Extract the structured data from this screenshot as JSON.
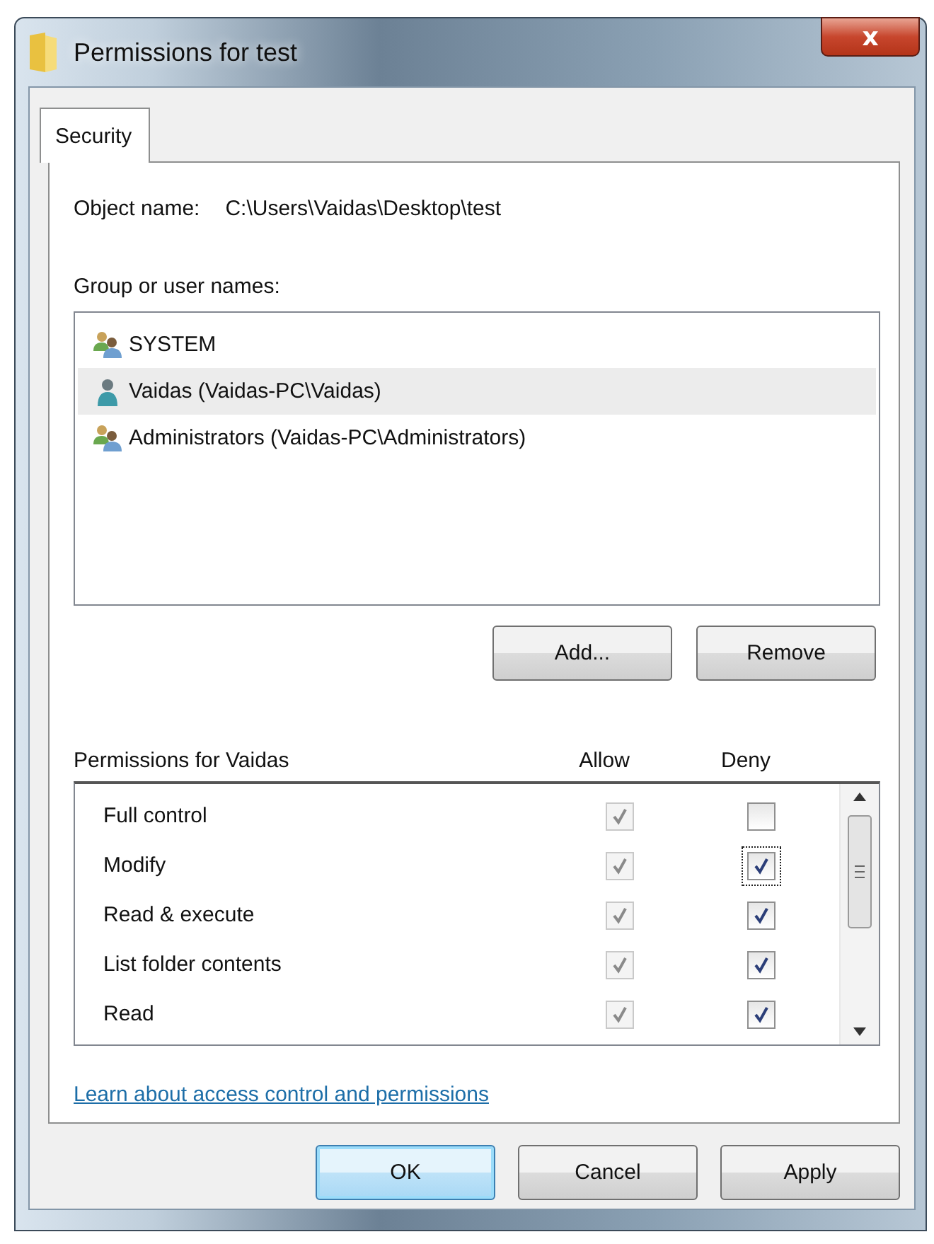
{
  "window": {
    "title": "Permissions for test",
    "close": "x"
  },
  "tabs": [
    {
      "label": "Security",
      "selected": true
    }
  ],
  "object_name": {
    "label": "Object name:",
    "value": "C:\\Users\\Vaidas\\Desktop\\test"
  },
  "users_label": "Group or user names:",
  "users": [
    {
      "name": "SYSTEM",
      "kind": "group",
      "selected": false
    },
    {
      "name": "Vaidas (Vaidas-PC\\Vaidas)",
      "kind": "user",
      "selected": true
    },
    {
      "name": "Administrators (Vaidas-PC\\Administrators)",
      "kind": "group",
      "selected": false
    }
  ],
  "user_buttons": [
    "Add...",
    "Remove"
  ],
  "permissions_header": {
    "title": "Permissions for Vaidas",
    "allow": "Allow",
    "deny": "Deny"
  },
  "permissions": [
    {
      "name": "Full control",
      "allow": {
        "checked": true,
        "disabled": true
      },
      "deny": {
        "checked": false,
        "disabled": false,
        "focused": false
      }
    },
    {
      "name": "Modify",
      "allow": {
        "checked": true,
        "disabled": true
      },
      "deny": {
        "checked": true,
        "disabled": false,
        "focused": true
      }
    },
    {
      "name": "Read & execute",
      "allow": {
        "checked": true,
        "disabled": true
      },
      "deny": {
        "checked": true,
        "disabled": false,
        "focused": false
      }
    },
    {
      "name": "List folder contents",
      "allow": {
        "checked": true,
        "disabled": true
      },
      "deny": {
        "checked": true,
        "disabled": false,
        "focused": false
      }
    },
    {
      "name": "Read",
      "allow": {
        "checked": true,
        "disabled": true
      },
      "deny": {
        "checked": true,
        "disabled": false,
        "focused": false
      }
    }
  ],
  "help_link": "Learn about access control and permissions",
  "buttons": [
    {
      "label": "OK",
      "default": true
    },
    {
      "label": "Cancel",
      "default": false
    },
    {
      "label": "Apply",
      "default": false
    }
  ]
}
